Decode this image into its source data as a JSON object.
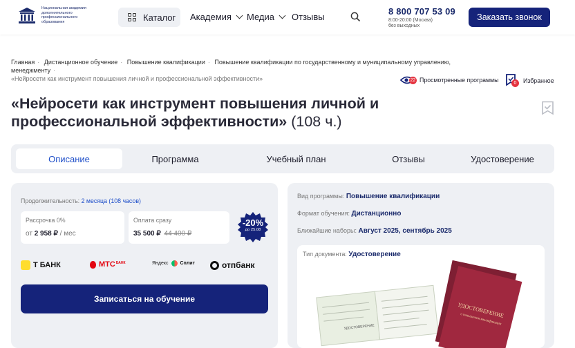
{
  "header": {
    "logo_lines": [
      "Национальная академия",
      "дополнительного",
      "профессионального",
      "образования"
    ],
    "catalog_label": "Каталог",
    "nav": [
      {
        "label": "Академия",
        "dropdown": true
      },
      {
        "label": "Медиа",
        "dropdown": true
      },
      {
        "label": "Отзывы",
        "dropdown": false
      }
    ],
    "phone": "8 800 707 53 09",
    "phone_hours": "8:00-20:00 (Москва)",
    "phone_days": "без выходных",
    "call_button": "Заказать звонок"
  },
  "breadcrumbs": [
    "Главная",
    "Дистанционное обучение",
    "Повышение квалификации",
    "Повышение квалификации по государственному и муниципальному управлению, менеджменту",
    "«Нейросети как инструмент повышения личной и профессиональной эффективности»"
  ],
  "viewed": {
    "label": "Просмотренные программы",
    "count": "22"
  },
  "favorites": {
    "label": "Избранное",
    "count": "0"
  },
  "title": {
    "main": "«Нейросети как инструмент повышения личной и профессиональной эффективности»",
    "hours": "(108 ч.)"
  },
  "tabs": [
    "Описание",
    "Программа",
    "Учебный план",
    "Отзывы",
    "Удостоверение"
  ],
  "pricing": {
    "duration_label": "Продолжительность:",
    "duration_value": "2 месяца (108 часов)",
    "installment_label": "Рассрочка 0%",
    "installment_prefix": "от",
    "installment_value": "2 958 ₽",
    "installment_suffix": "/ мес",
    "full_label": "Оплата сразу",
    "full_price": "35 500 ₽",
    "old_price": "44 400 ₽",
    "discount": "-20%",
    "discount_until": "до 25.08",
    "banks": [
      "Т БАНК",
      "МТС",
      "БАНК",
      "Яндекс",
      "Сплит",
      "отпбанк"
    ],
    "enroll_button": "Записаться на обучение"
  },
  "program_info": [
    {
      "label": "Вид программы:",
      "value": "Повышение квалификации"
    },
    {
      "label": "Формат обучения:",
      "value": "Дистанционно"
    },
    {
      "label": "Ближайшие наборы:",
      "value": "Август 2025, сентябрь 2025"
    }
  ],
  "document": {
    "label": "Тип документа:",
    "value": "Удостоверение",
    "cover_title": "УДОСТОВЕРЕНИЕ",
    "cover_subtitle": "о повышении квалификации",
    "page_text": "УДОСТОВЕРЕНИЕ"
  },
  "colors": {
    "brand": "#15237a",
    "accent": "#1f4fc9",
    "badge": "#e5333f",
    "discount": "#15237a"
  }
}
